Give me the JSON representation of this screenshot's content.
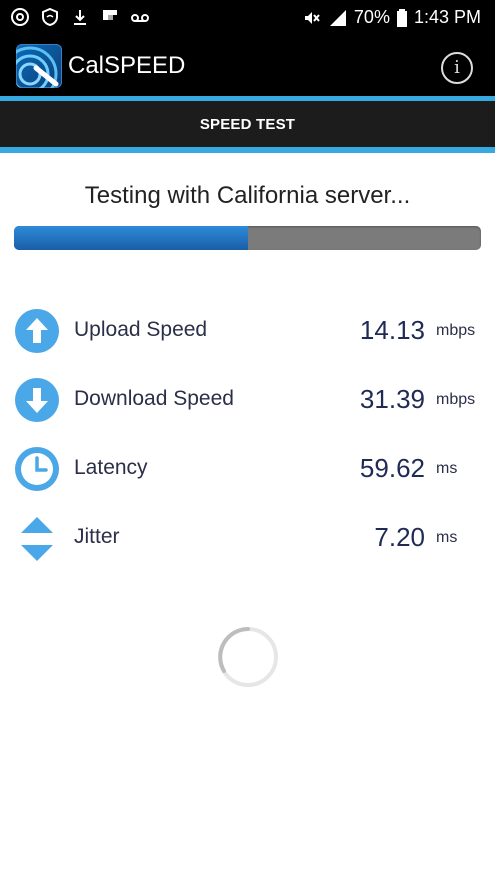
{
  "status_bar": {
    "battery": "70%",
    "time": "1:43 PM"
  },
  "app_bar": {
    "title": "CalSPEED",
    "info_icon": "info-icon"
  },
  "tab": {
    "label": "SPEED TEST"
  },
  "test": {
    "status": "Testing with California server...",
    "progress_fraction": 0.5
  },
  "metrics": [
    {
      "label": "Upload Speed",
      "value": "14.13",
      "unit": "mbps",
      "icon": "upload-arrow-icon"
    },
    {
      "label": "Download Speed",
      "value": "31.39",
      "unit": "mbps",
      "icon": "download-arrow-icon"
    },
    {
      "label": "Latency",
      "value": "59.62",
      "unit": "ms",
      "icon": "clock-icon"
    },
    {
      "label": "Jitter",
      "value": "7.20",
      "unit": "ms",
      "icon": "up-down-arrows-icon"
    }
  ],
  "colors": {
    "accent": "#36a9e1",
    "icon_blue": "#4aa8e8",
    "progress_blue": "#1f6fc0"
  }
}
